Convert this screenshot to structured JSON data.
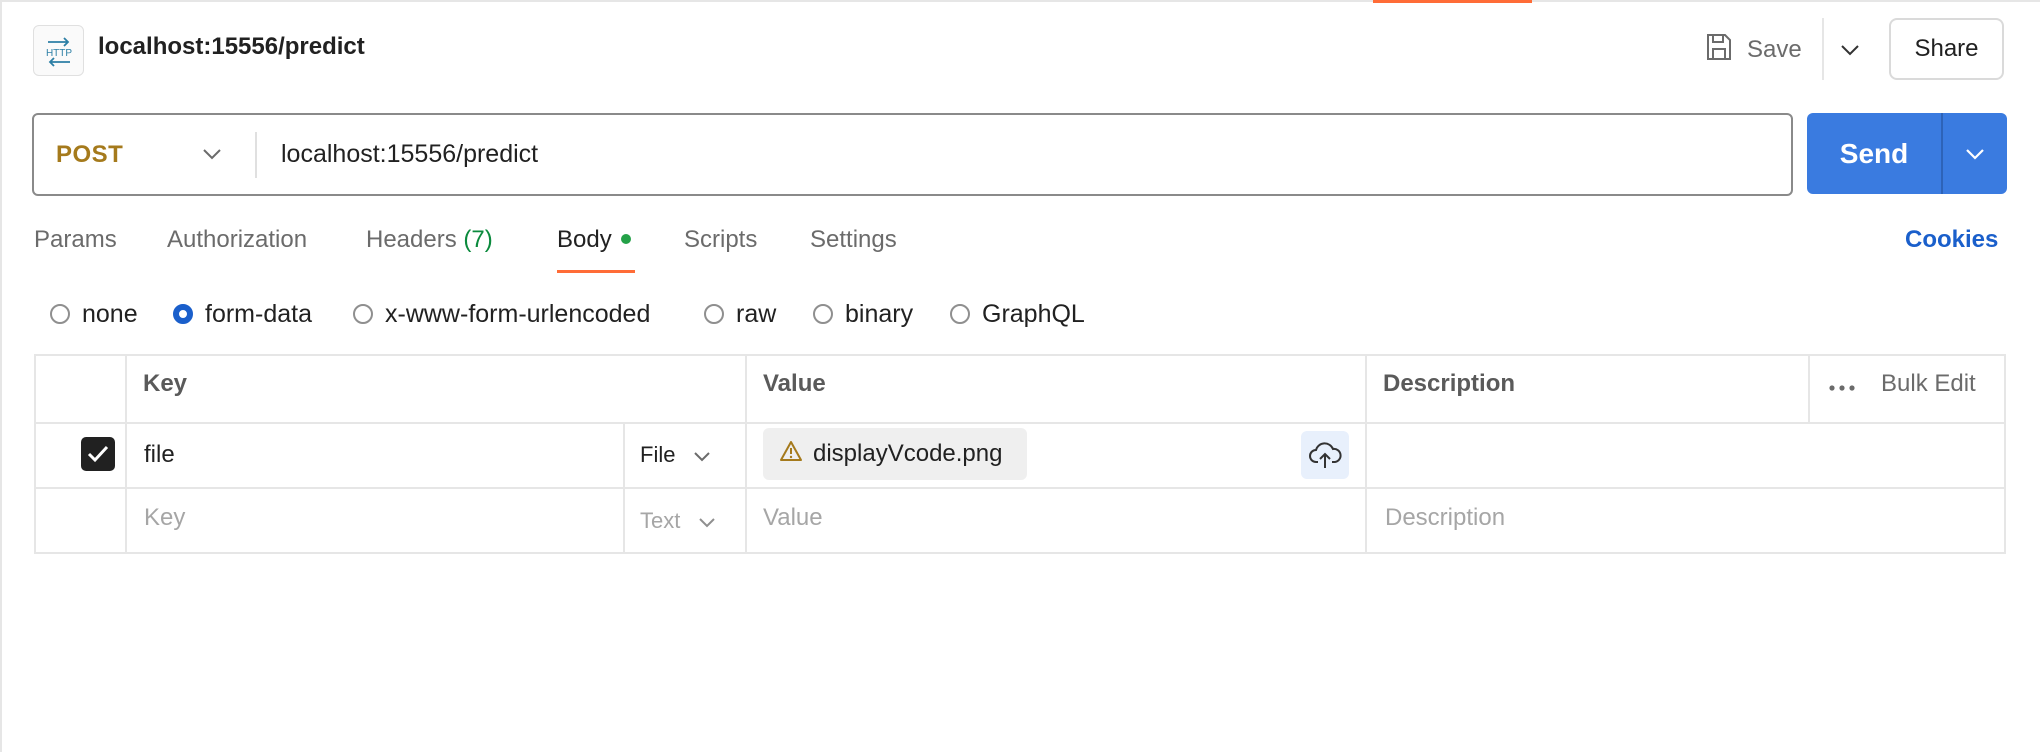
{
  "header": {
    "icon": "http-icon",
    "title": "localhost:15556/predict",
    "save_label": "Save",
    "share_label": "Share"
  },
  "request": {
    "method": "POST",
    "method_color": "#a57a1c",
    "url": "localhost:15556/predict",
    "send_label": "Send",
    "send_color": "#3a7be0"
  },
  "tabs": {
    "params": "Params",
    "authorization": "Authorization",
    "headers": "Headers",
    "headers_count": "(7)",
    "body": "Body",
    "scripts": "Scripts",
    "settings": "Settings",
    "active": "Body",
    "cookies": "Cookies"
  },
  "body_types": {
    "none": "none",
    "form_data": "form-data",
    "urlencoded": "x-www-form-urlencoded",
    "raw": "raw",
    "binary": "binary",
    "graphql": "GraphQL",
    "selected": "form-data"
  },
  "table": {
    "headers": {
      "key": "Key",
      "value": "Value",
      "description": "Description",
      "bulk_edit": "Bulk Edit"
    },
    "rows": [
      {
        "checked": true,
        "key": "file",
        "type": "File",
        "value": "displayVcode.png",
        "value_warning": true,
        "description": ""
      }
    ],
    "new_row": {
      "key_placeholder": "Key",
      "type": "Text",
      "value_placeholder": "Value",
      "description_placeholder": "Description"
    }
  },
  "accent_color": "#ff6c37"
}
